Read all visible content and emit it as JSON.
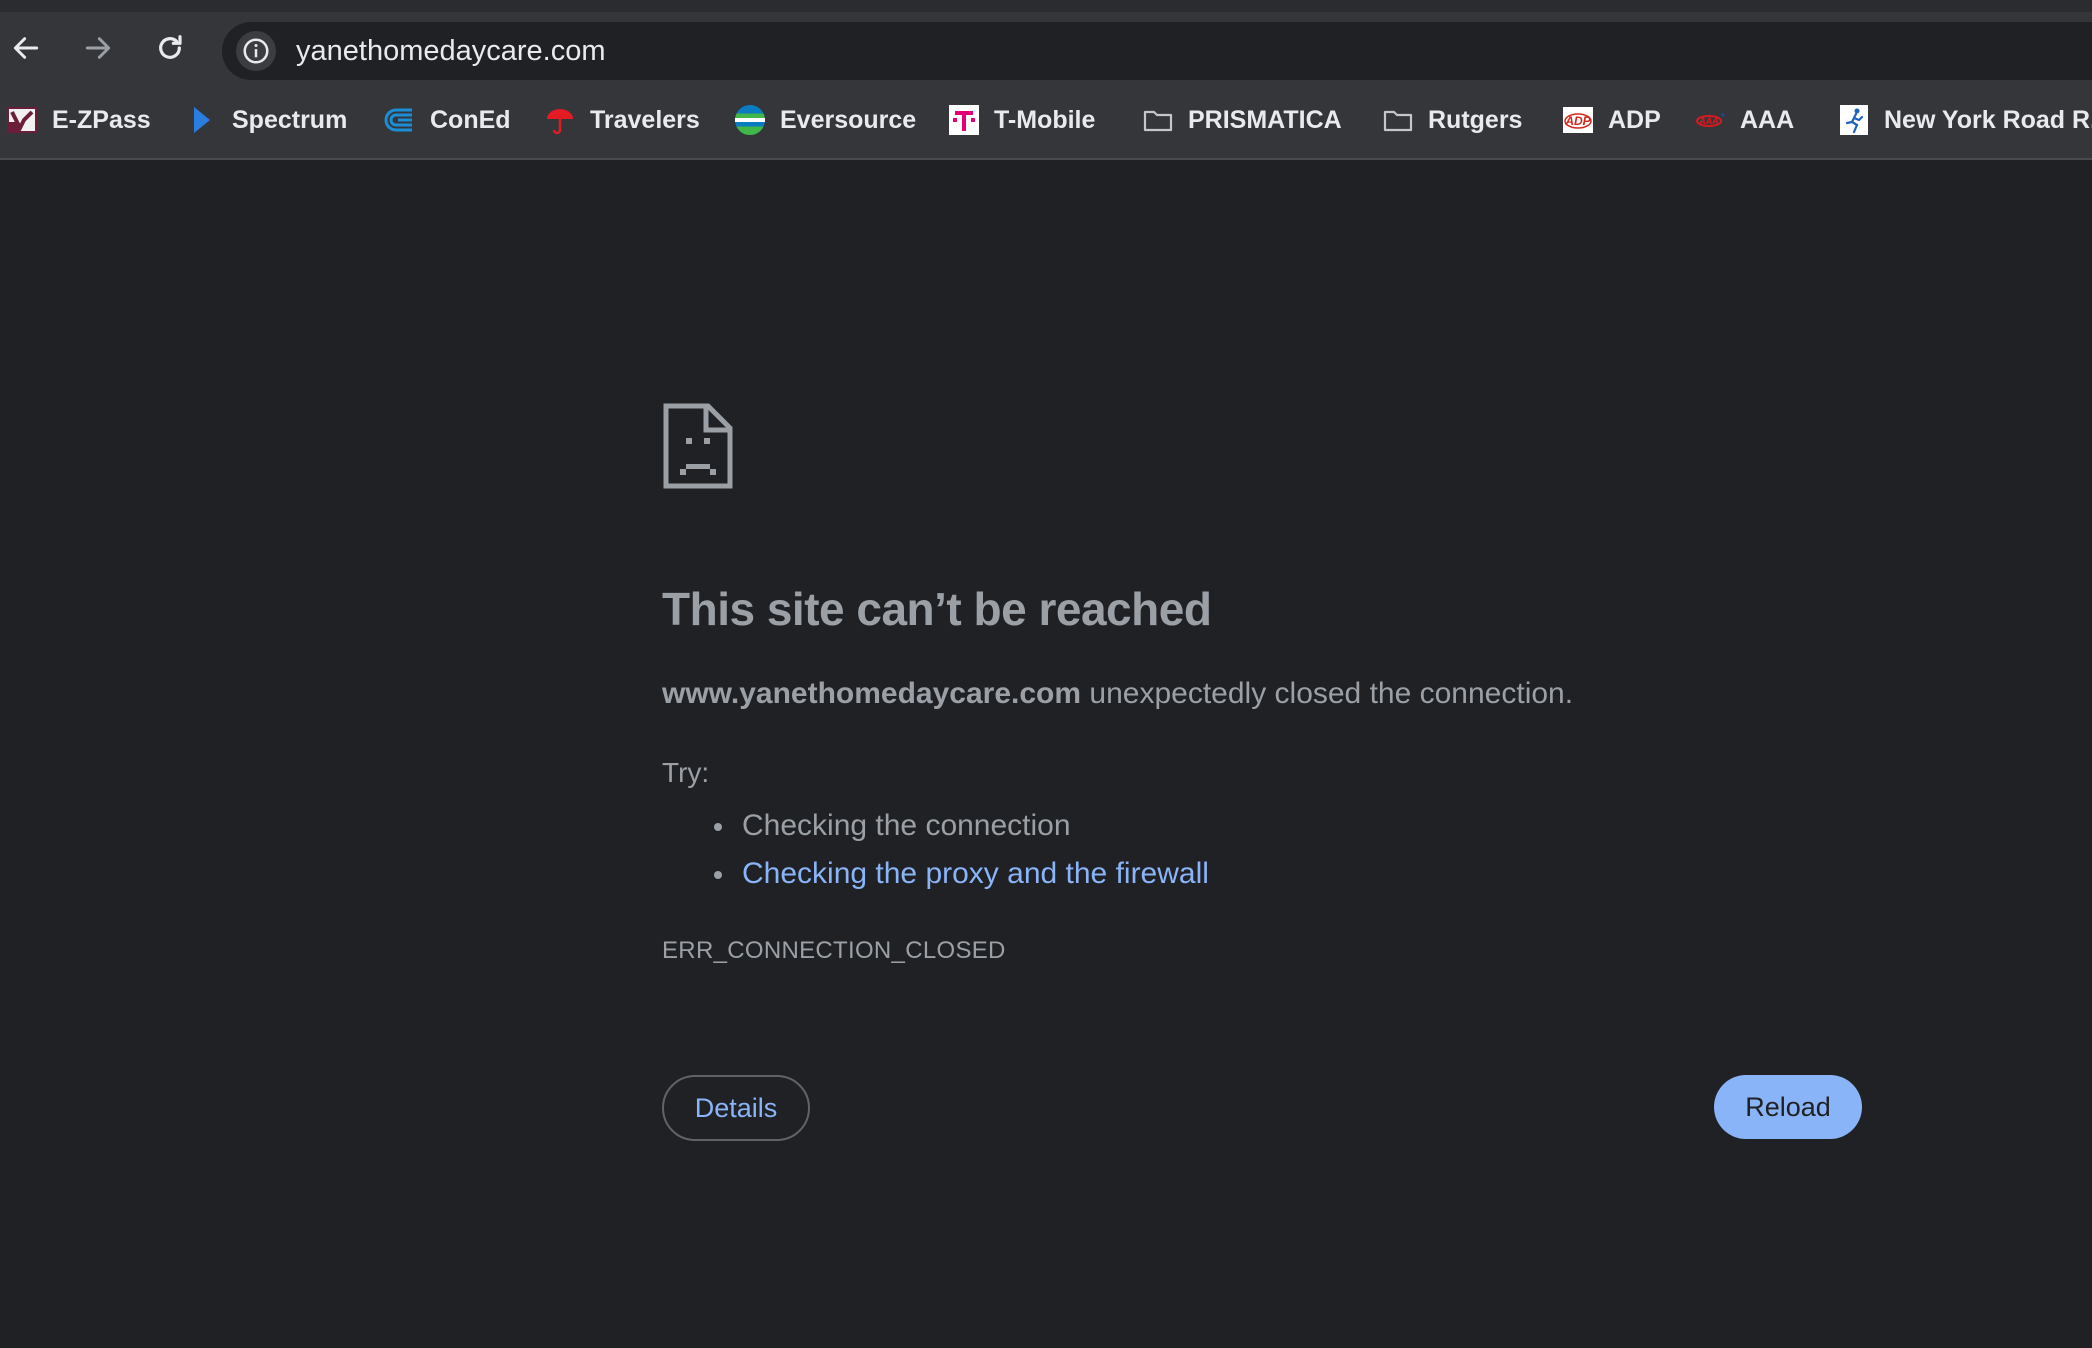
{
  "browser": {
    "url": "yanethomedaycare.com",
    "bookmarks": [
      {
        "label": "E-ZPass",
        "icon": "ezpass-icon"
      },
      {
        "label": "Spectrum",
        "icon": "spectrum-icon"
      },
      {
        "label": "ConEd",
        "icon": "coned-icon"
      },
      {
        "label": "Travelers",
        "icon": "travelers-umbrella-icon"
      },
      {
        "label": "Eversource",
        "icon": "eversource-icon"
      },
      {
        "label": "T-Mobile",
        "icon": "tmobile-icon"
      },
      {
        "label": "PRISMATICA",
        "icon": "folder-icon"
      },
      {
        "label": "Rutgers",
        "icon": "folder-icon"
      },
      {
        "label": "ADP",
        "icon": "adp-icon"
      },
      {
        "label": "AAA",
        "icon": "aaa-icon"
      },
      {
        "label": "New York Road R...",
        "icon": "nyrr-runner-icon"
      }
    ]
  },
  "error": {
    "title": "This site can’t be reached",
    "host": "www.yanethomedaycare.com",
    "message_rest": " unexpectedly closed the connection.",
    "try_label": "Try:",
    "suggestions": [
      "Checking the connection",
      "Checking the proxy and the firewall"
    ],
    "code": "ERR_CONNECTION_CLOSED",
    "details_label": "Details",
    "reload_label": "Reload"
  },
  "colors": {
    "background": "#202124",
    "toolbar": "#35363a",
    "text_muted": "#9aa0a6",
    "link": "#8ab4f8",
    "reload_button": "#8ab4f8"
  }
}
